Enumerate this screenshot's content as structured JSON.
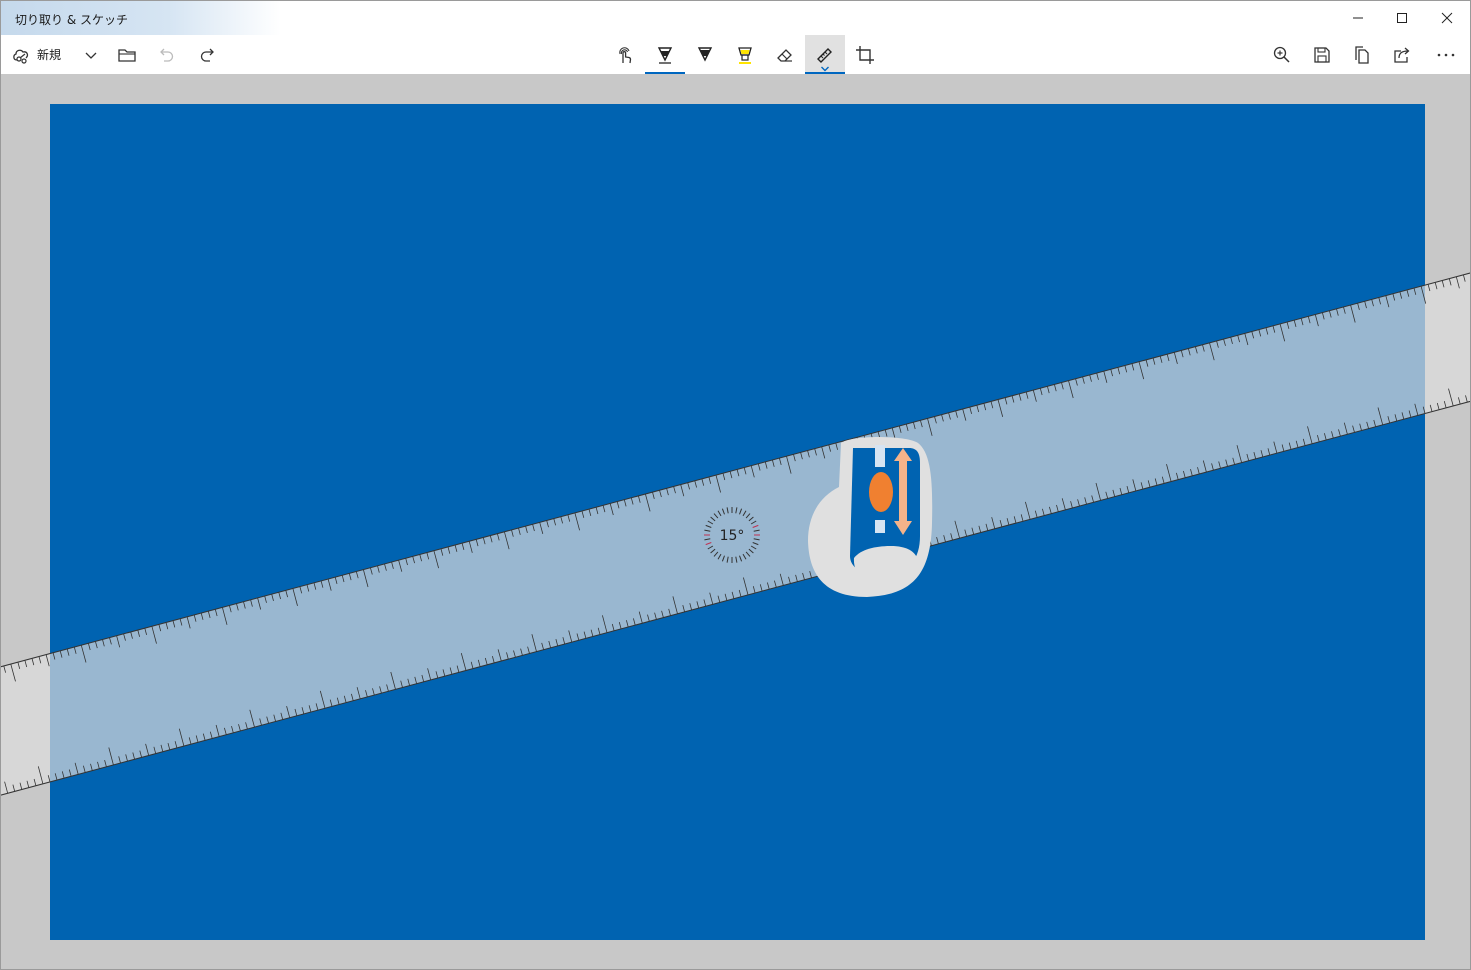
{
  "window": {
    "title": "切り取り & スケッチ",
    "controls": [
      "minimize",
      "maximize",
      "close"
    ]
  },
  "toolbar": {
    "new_label": "新規",
    "left_icons": [
      "new-snip-icon",
      "chevron-down-icon",
      "open-folder-icon",
      "undo-icon",
      "redo-icon"
    ],
    "center_tools": [
      "touch-writing-icon",
      "ballpoint-pen-icon",
      "pencil-icon",
      "highlighter-icon",
      "eraser-icon",
      "ruler-icon",
      "crop-icon"
    ],
    "active_tool": "ruler-icon",
    "right_icons": [
      "zoom-icon",
      "save-icon",
      "copy-icon",
      "share-icon",
      "more-icon"
    ]
  },
  "ruler": {
    "angle_label": "15°",
    "angle_degrees": 15
  },
  "colors": {
    "accent": "#0067c0",
    "image_fill": "#0063b1",
    "canvas_bg": "#c8c8c8",
    "ruler_fill": "#dedede",
    "mouse_accent": "#f08030",
    "highlighter_yellow": "#ffe400"
  }
}
